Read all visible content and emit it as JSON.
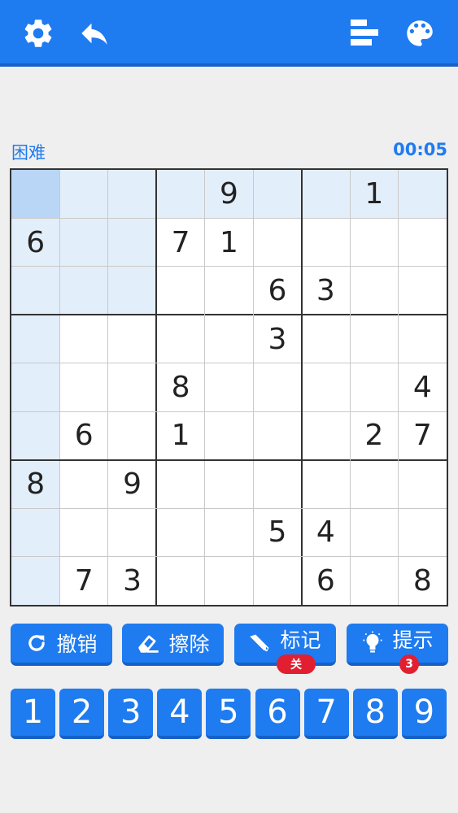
{
  "header": {
    "icons": [
      "gear-icon",
      "undo-arrow-icon",
      "leaderboard-icon",
      "palette-icon"
    ]
  },
  "game": {
    "difficulty": "困难",
    "timer": "00:05"
  },
  "board": {
    "rows": [
      [
        "",
        "",
        "",
        "",
        "9",
        "",
        "",
        "1",
        ""
      ],
      [
        "6",
        "",
        "",
        "7",
        "1",
        "",
        "",
        "",
        ""
      ],
      [
        "",
        "",
        "",
        "",
        "",
        "6",
        "3",
        "",
        ""
      ],
      [
        "",
        "",
        "",
        "",
        "",
        "3",
        "",
        "",
        ""
      ],
      [
        "",
        "",
        "",
        "8",
        "",
        "",
        "",
        "",
        "4"
      ],
      [
        "",
        "6",
        "",
        "1",
        "",
        "",
        "",
        "2",
        "7"
      ],
      [
        "8",
        "",
        "9",
        "",
        "",
        "",
        "",
        "",
        ""
      ],
      [
        "",
        "",
        "",
        "",
        "",
        "5",
        "4",
        "",
        ""
      ],
      [
        "",
        "7",
        "3",
        "",
        "",
        "",
        "6",
        "",
        "8"
      ]
    ],
    "selected_cell": [
      0,
      0
    ]
  },
  "actions": {
    "undo": "撤销",
    "erase": "擦除",
    "notes": "标记",
    "notes_state": "关",
    "hint": "提示",
    "hint_count": "3"
  },
  "numpad": [
    "1",
    "2",
    "3",
    "4",
    "5",
    "6",
    "7",
    "8",
    "9"
  ],
  "colors": {
    "primary": "#1f7bf0",
    "primary_dark": "#1560c9",
    "highlight": "#e3eefb",
    "selected": "#b9d6f7",
    "badge": "#e21f31"
  }
}
